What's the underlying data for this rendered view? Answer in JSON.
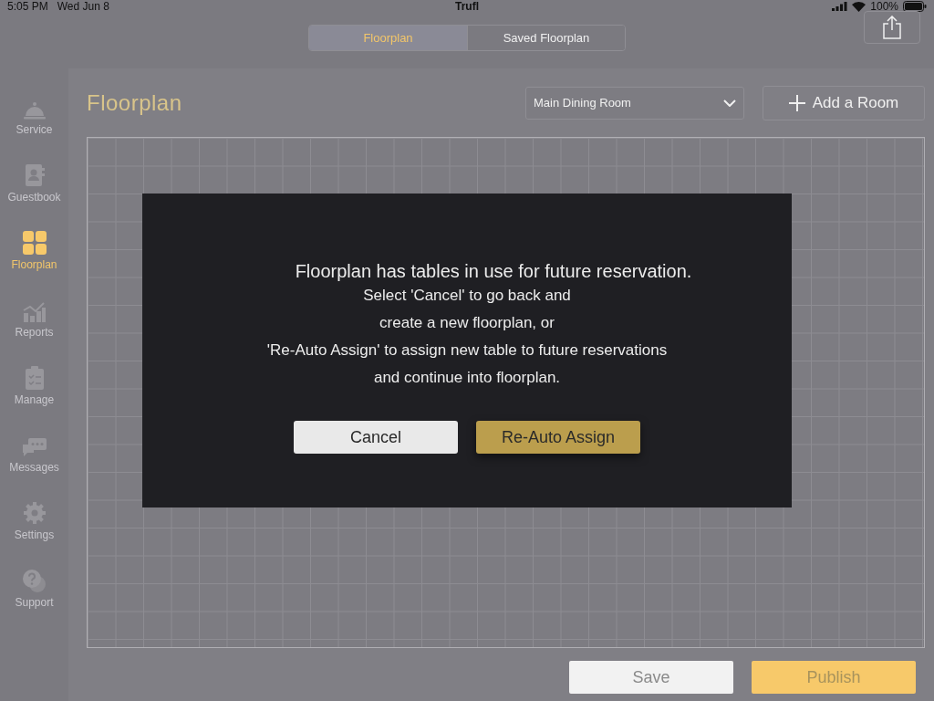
{
  "status_bar": {
    "time": "5:05 PM",
    "date": "Wed Jun 8",
    "app": "Trufl",
    "battery": "100%"
  },
  "tabs": [
    {
      "label": "Floorplan",
      "selected": true
    },
    {
      "label": "Saved Floorplan",
      "selected": false
    }
  ],
  "sidebar": {
    "items": [
      {
        "label": "Service",
        "selected": false
      },
      {
        "label": "Guestbook",
        "selected": false
      },
      {
        "label": "Floorplan",
        "selected": true
      },
      {
        "label": "Reports",
        "selected": false
      },
      {
        "label": "Manage",
        "selected": false
      },
      {
        "label": "Messages",
        "selected": false
      },
      {
        "label": "Settings",
        "selected": false
      },
      {
        "label": "Support",
        "selected": false
      }
    ]
  },
  "page_title": "Floorplan",
  "room_select": {
    "value": "Main Dining Room"
  },
  "add_room_button": "Add a Room",
  "dialog": {
    "title": "Floorplan has tables in use for future reservation.",
    "lines": [
      "Select 'Cancel' to go back and",
      "create a new floorplan, or",
      "'Re-Auto Assign' to assign new table to future reservations",
      "and continue into floorplan."
    ],
    "buttons": [
      {
        "label": "Cancel",
        "kind": "secondary"
      },
      {
        "label": "Re-Auto Assign",
        "kind": "primary"
      }
    ]
  },
  "footer_buttons": [
    {
      "label": "Save",
      "kind": "secondary"
    },
    {
      "label": "Publish",
      "kind": "primary"
    }
  ]
}
